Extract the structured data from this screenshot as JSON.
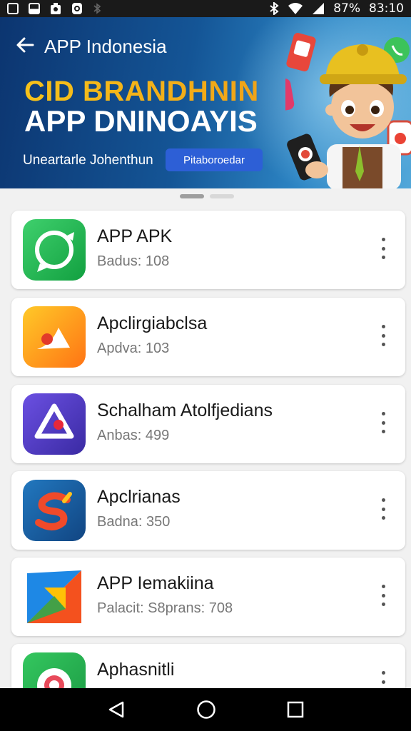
{
  "status_bar": {
    "battery": "87%",
    "time": "83:10",
    "left_icons": [
      "image-icon",
      "image-icon",
      "notification-icon",
      "notification-icon",
      "bluetooth-icon"
    ],
    "right_icons": [
      "bluetooth-icon",
      "wifi-icon",
      "signal-icon"
    ]
  },
  "header": {
    "back_icon": "back-arrow-icon",
    "title": "APP Indonesia"
  },
  "banner": {
    "headline_1": "CID BRANDHNIN",
    "headline_2": "APP DNINOAYIS",
    "tagline": "Uneartarle Johenthun",
    "chip_label": "Pitaboroedar"
  },
  "pager": {
    "count": 2,
    "active": 0
  },
  "apps": [
    {
      "name": "APP APK",
      "meta": "Badus: 108",
      "icon": "chat-bubble-icon",
      "colors": [
        "#31c862",
        "#13a344"
      ]
    },
    {
      "name": "Apclirgiabclsa",
      "meta": "Apdva: 103",
      "icon": "music-note-icon",
      "colors": [
        "#ffc21e",
        "#ff7a12"
      ]
    },
    {
      "name": "Schalham Atolfjedians",
      "meta": "Anbas: 499",
      "icon": "shield-swirl-icon",
      "colors": [
        "#6a4fe0",
        "#3a2aa3"
      ]
    },
    {
      "name": "Apclrianas",
      "meta": "Badna: 350",
      "icon": "swirl-s-icon",
      "colors": [
        "#1f6fb3",
        "#124a86"
      ]
    },
    {
      "name": "APP Iemakiina",
      "meta": "Palacit: S8prans: 708",
      "icon": "play-triangle-icon",
      "colors": [
        "#ffffff",
        "#f2f2f2"
      ]
    },
    {
      "name": "Aphasnitli",
      "meta": "",
      "icon": "target-ring-icon",
      "colors": [
        "#2fbf5a",
        "#1c9b44"
      ]
    }
  ],
  "nav": [
    "back-triangle-icon",
    "home-circle-icon",
    "recents-square-icon"
  ]
}
